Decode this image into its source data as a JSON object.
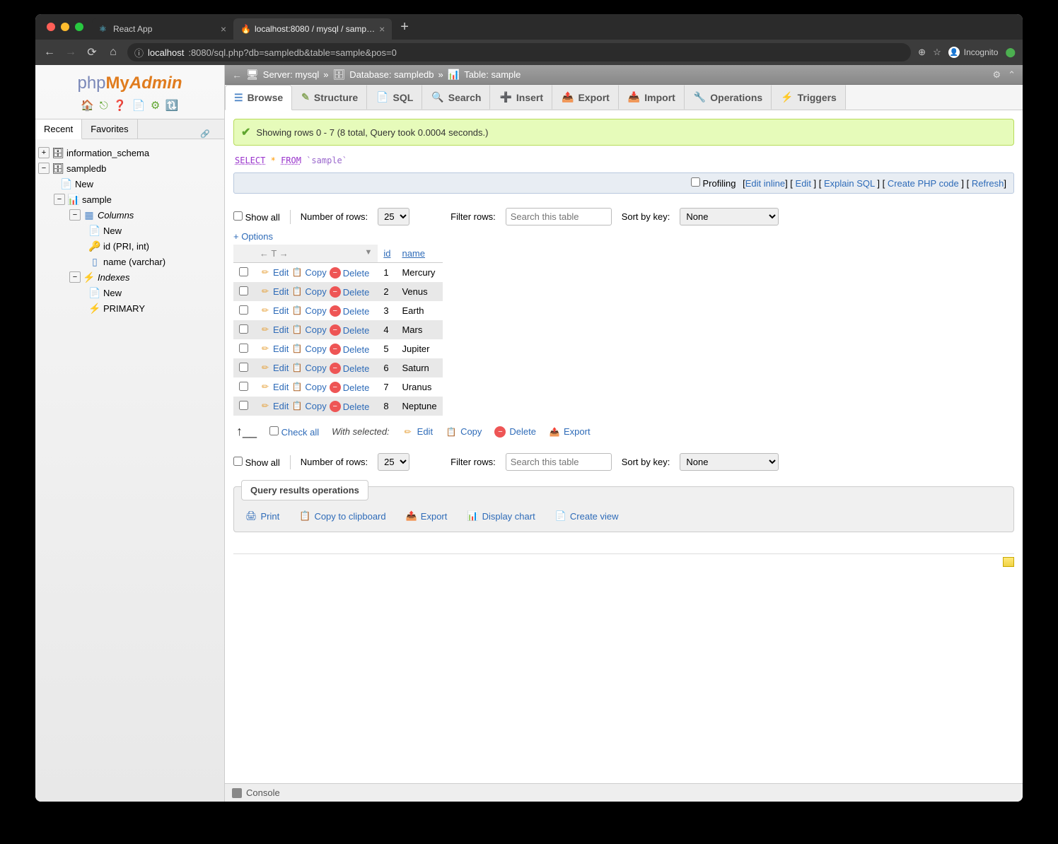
{
  "browser": {
    "tabs": [
      {
        "title": "React App",
        "icon": "⚛"
      },
      {
        "title": "localhost:8080 / mysql / samp…",
        "icon": "🔥"
      }
    ],
    "url_prefix": "localhost",
    "url_rest": ":8080/sql.php?db=sampledb&table=sample&pos=0",
    "incognito": "Incognito"
  },
  "sidebar": {
    "logo": {
      "php": "php",
      "my": "My",
      "admin": "Admin"
    },
    "tabs": {
      "recent": "Recent",
      "favorites": "Favorites"
    },
    "tree": {
      "info_schema": "information_schema",
      "sampledb": "sampledb",
      "new1": "New",
      "sample": "sample",
      "columns": "Columns",
      "new2": "New",
      "id_col": "id (PRI, int)",
      "name_col": "name (varchar)",
      "indexes": "Indexes",
      "new3": "New",
      "primary": "PRIMARY"
    }
  },
  "breadcrumb": {
    "server_label": "Server: mysql",
    "db_label": "Database: sampledb",
    "table_label": "Table: sample"
  },
  "nav_tabs": {
    "browse": "Browse",
    "structure": "Structure",
    "sql": "SQL",
    "search": "Search",
    "insert": "Insert",
    "export": "Export",
    "import": "Import",
    "operations": "Operations",
    "triggers": "Triggers"
  },
  "success_msg": "Showing rows 0 - 7 (8 total, Query took 0.0004 seconds.)",
  "sql": {
    "select": "SELECT",
    "star": "*",
    "from": "FROM",
    "table": "`sample`"
  },
  "profiling_bar": {
    "profiling": "Profiling",
    "edit_inline": "Edit inline",
    "edit": "Edit",
    "explain": "Explain SQL",
    "create_php": "Create PHP code",
    "refresh": "Refresh"
  },
  "controls": {
    "show_all": "Show all",
    "num_rows_label": "Number of rows:",
    "num_rows_value": "25",
    "filter_label": "Filter rows:",
    "filter_placeholder": "Search this table",
    "sort_label": "Sort by key:",
    "sort_value": "None"
  },
  "options": "+ Options",
  "table": {
    "headers": {
      "id": "id",
      "name": "name"
    },
    "actions": {
      "edit": "Edit",
      "copy": "Copy",
      "delete": "Delete"
    },
    "rows": [
      {
        "id": "1",
        "name": "Mercury"
      },
      {
        "id": "2",
        "name": "Venus"
      },
      {
        "id": "3",
        "name": "Earth"
      },
      {
        "id": "4",
        "name": "Mars"
      },
      {
        "id": "5",
        "name": "Jupiter"
      },
      {
        "id": "6",
        "name": "Saturn"
      },
      {
        "id": "7",
        "name": "Uranus"
      },
      {
        "id": "8",
        "name": "Neptune"
      }
    ]
  },
  "batch": {
    "check_all": "Check all",
    "with_selected": "With selected:",
    "edit": "Edit",
    "copy": "Copy",
    "delete": "Delete",
    "export": "Export"
  },
  "qro": {
    "legend": "Query results operations",
    "print": "Print",
    "copy_clipboard": "Copy to clipboard",
    "export": "Export",
    "display_chart": "Display chart",
    "create_view": "Create view"
  },
  "console": "Console"
}
